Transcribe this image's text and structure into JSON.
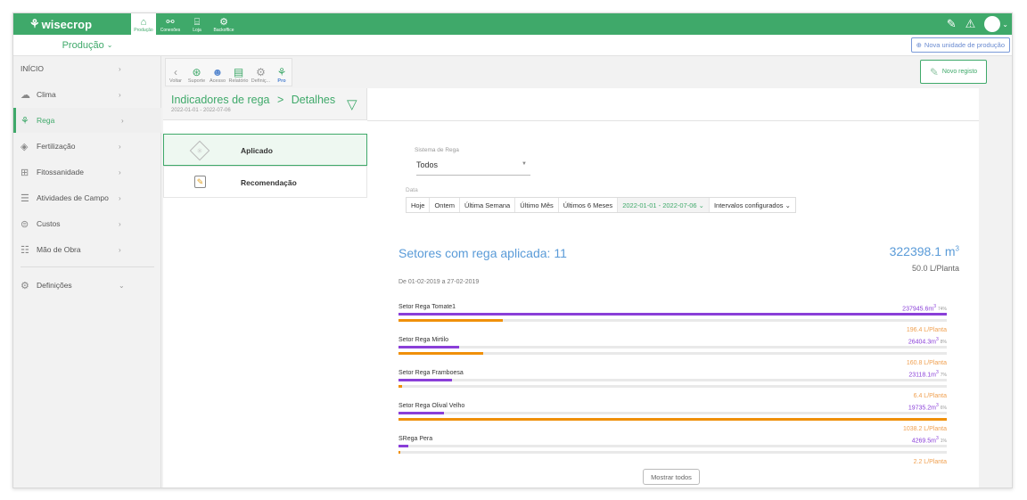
{
  "app": {
    "brand": "wisecrop"
  },
  "nav": {
    "tabs": [
      {
        "label": "Produção",
        "icon": "house-icon"
      },
      {
        "label": "Conexões",
        "icon": "network-icon"
      },
      {
        "label": "Loja",
        "icon": "store-icon"
      },
      {
        "label": "Backoffice",
        "icon": "user-gear-icon"
      }
    ],
    "right_icons": [
      "notes-icon",
      "warning-icon",
      "avatar"
    ]
  },
  "subbar": {
    "production_select": "Produção",
    "new_unit_button": "Nova unidade de produção"
  },
  "sidebar": {
    "items": [
      {
        "label": "INÍCIO",
        "icon": ""
      },
      {
        "label": "Clima",
        "icon": "cloud-icon"
      },
      {
        "label": "Rega",
        "icon": "sprinkler-icon"
      },
      {
        "label": "Fertilização",
        "icon": "fertilizer-icon"
      },
      {
        "label": "Fitossanidade",
        "icon": "plus-box-icon"
      },
      {
        "label": "Atividades de Campo",
        "icon": "list-icon"
      },
      {
        "label": "Custos",
        "icon": "coins-icon"
      },
      {
        "label": "Mão de Obra",
        "icon": "workers-icon"
      },
      {
        "label": "Definições",
        "icon": "gear-icon"
      }
    ]
  },
  "toolbar": {
    "tools": [
      {
        "label": "Voltar",
        "icon": "chevron-left-icon"
      },
      {
        "label": "Suporte",
        "icon": "lifebuoy-icon"
      },
      {
        "label": "Acesso",
        "icon": "user-icon"
      },
      {
        "label": "Relatório",
        "icon": "report-icon"
      },
      {
        "label": "Definiç...",
        "icon": "gear-icon"
      },
      {
        "label": "Pro",
        "icon": "sprinkler-icon"
      }
    ],
    "new_record": "Novo registo"
  },
  "breadcrumb": {
    "parent": "Indicadores de rega",
    "separator": ">",
    "current": "Detalhes",
    "range": "2022-01-01 - 2022-07-06"
  },
  "modes": [
    {
      "label": "Aplicado",
      "active": true
    },
    {
      "label": "Recomendação",
      "active": false
    }
  ],
  "filters": {
    "system_label": "Sistema de Rega",
    "system_value": "Todos",
    "date_label": "Data",
    "date_tabs": [
      "Hoje",
      "Ontem",
      "Última Semana",
      "Último Mês",
      "Últimos 6 Meses",
      "2022-01-01 - 2022-07-06 ⌄",
      "Intervalos configurados ⌄"
    ],
    "date_selected": 5
  },
  "summary": {
    "title": "Setores com rega aplicada: 11",
    "total_volume": "322398.1 m",
    "total_volume_sup": "3",
    "total_per_plant": "50.0 L/Planta",
    "period": "De 01-02-2019 a 27-02-2019"
  },
  "sectors": [
    {
      "name": "Setor Rega Tomate1",
      "volume": "237945.6m",
      "pct": "74%",
      "per_plant": "196.4 L/Planta",
      "vol_fraction": 1.0,
      "plant_fraction": 0.19
    },
    {
      "name": "Setor Rega Mirtilo",
      "volume": "26404.3m",
      "pct": "8%",
      "per_plant": "160.8 L/Planta",
      "vol_fraction": 0.11,
      "plant_fraction": 0.155
    },
    {
      "name": "Setor Rega Framboesa",
      "volume": "23118.1m",
      "pct": "7%",
      "per_plant": "6.4 L/Planta",
      "vol_fraction": 0.097,
      "plant_fraction": 0.006
    },
    {
      "name": "Setor Rega Olival Velho",
      "volume": "19735.2m",
      "pct": "6%",
      "per_plant": "1038.2 L/Planta",
      "vol_fraction": 0.083,
      "plant_fraction": 1.0
    },
    {
      "name": "SRega Pera",
      "volume": "4269.5m",
      "pct": "1%",
      "per_plant": "2.2 L/Planta",
      "vol_fraction": 0.018,
      "plant_fraction": 0.002
    }
  ],
  "show_all": "Mostrar todos",
  "colors": {
    "primary": "#3fa96a",
    "volume_bar": "#8a3fd8",
    "plant_bar": "#f0900a",
    "title": "#5a9bd8"
  }
}
